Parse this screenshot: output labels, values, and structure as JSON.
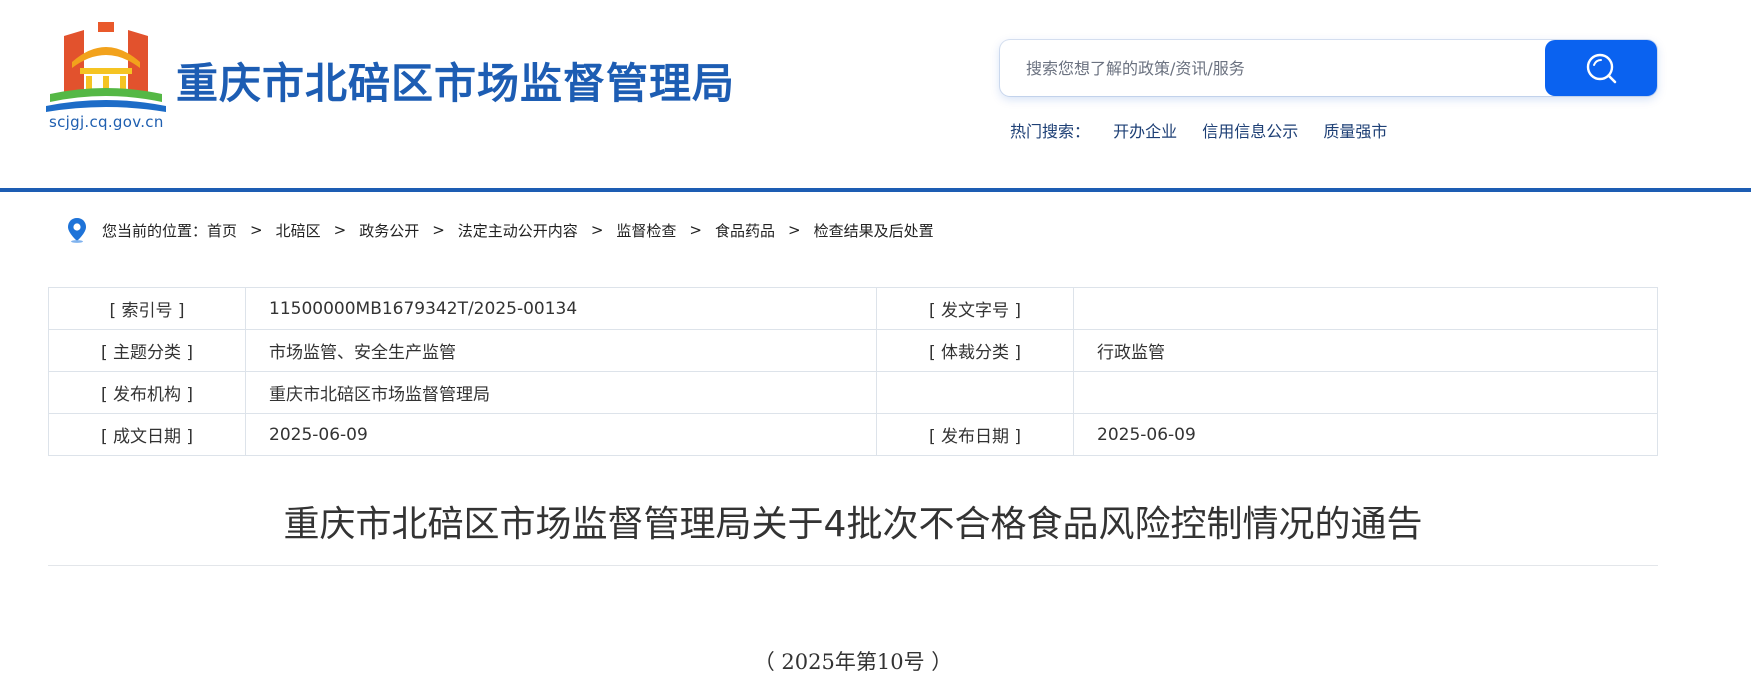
{
  "header": {
    "site_title": "重庆市北碚区市场监督管理局",
    "domain": "scjgj.cq.gov.cn",
    "logo_icon": "city-gate-emblem-icon",
    "search": {
      "placeholder": "搜索您想了解的政策/资讯/服务",
      "value": ""
    },
    "hot_label": "热门搜索：",
    "hot_links": [
      "开办企业",
      "信用信息公示",
      "质量强市"
    ]
  },
  "breadcrumb": {
    "prefix": "您当前的位置：",
    "items": [
      "首页",
      "北碚区",
      "政务公开",
      "法定主动公开内容",
      "监督检查",
      "食品药品",
      "检查结果及后处置"
    ],
    "separator": ">"
  },
  "info_table": {
    "index_label": "[ 索引号 ]",
    "index_value": "11500000MB1679342T/2025-00134",
    "doc_no_label": "[ 发文字号 ]",
    "doc_no_value": "",
    "topic_label": "[ 主题分类 ]",
    "topic_value": "市场监管、安全生产监管",
    "genre_label": "[ 体裁分类 ]",
    "genre_value": "行政监管",
    "publisher_label": "[ 发布机构 ]",
    "publisher_value": "重庆市北碚区市场监督管理局",
    "created_label": "[ 成文日期 ]",
    "created_value": "2025-06-09",
    "published_label": "[ 发布日期 ]",
    "published_value": "2025-06-09"
  },
  "article": {
    "title": "重庆市北碚区市场监督管理局关于4批次不合格食品风险控制情况的通告",
    "doc_number": "（ 2025年第10号 ）"
  },
  "colors": {
    "brand_blue": "#1d5db3",
    "search_button": "#0a62f0"
  }
}
